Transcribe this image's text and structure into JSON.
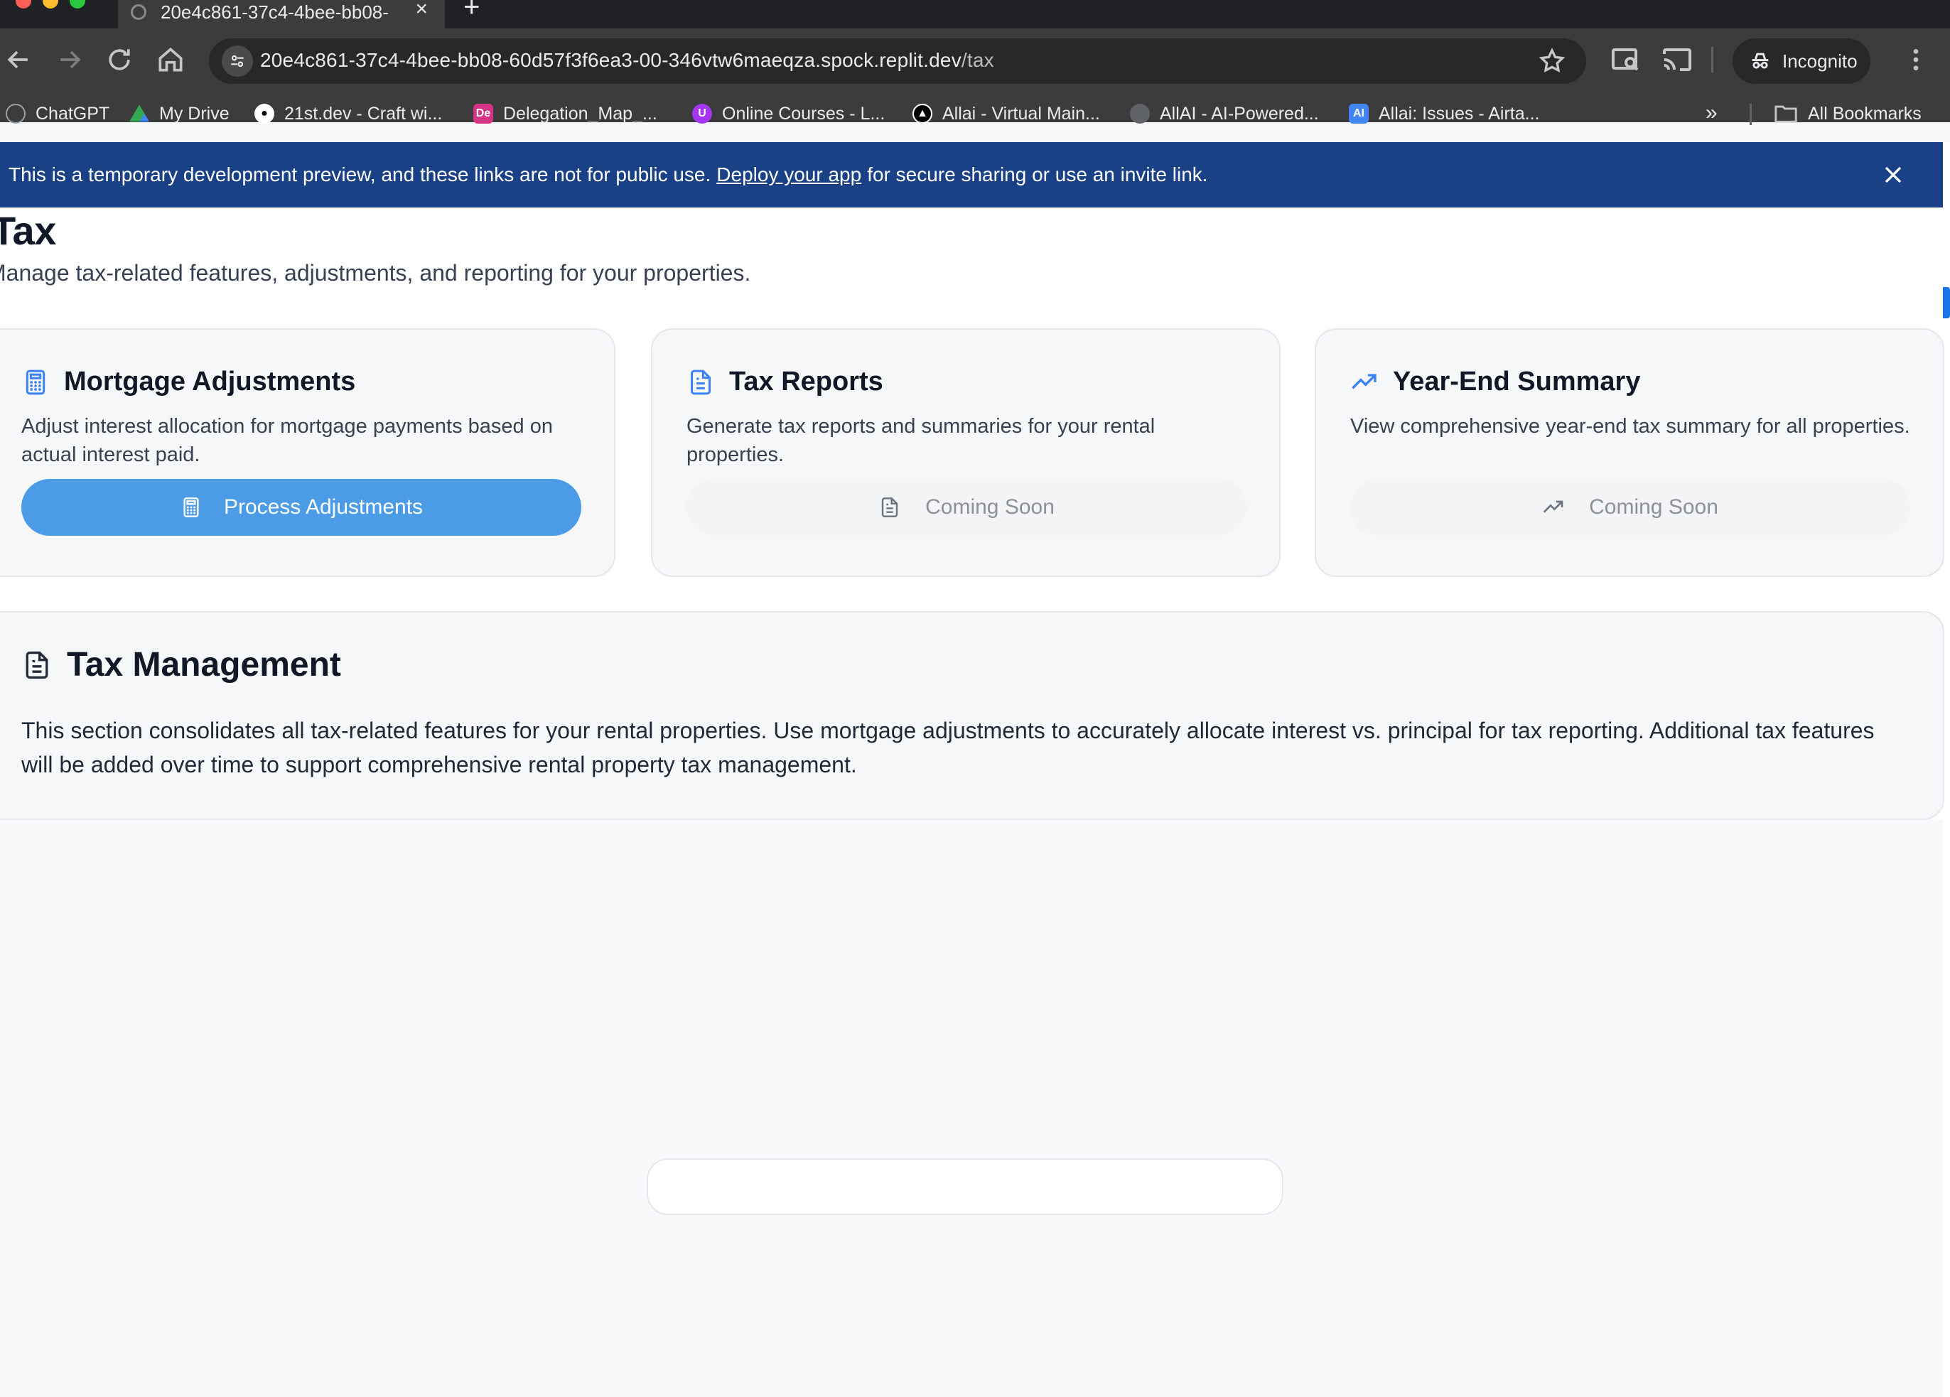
{
  "browser": {
    "tab_title": "20e4c861-37c4-4bee-bb08-",
    "url_host": "20e4c861-37c4-4bee-bb08-60d57f3f6ea3-00-346vtw6maeqza.spock.replit.dev",
    "url_path": "/tax",
    "incognito_label": "Incognito",
    "bookmarks": [
      {
        "label": "ChatGPT",
        "icon": "chatgpt-icon",
        "color": "#3c3c3c"
      },
      {
        "label": "My Drive",
        "icon": "google-drive-icon",
        "color": "#34a853"
      },
      {
        "label": "21st.dev - Craft wi...",
        "icon": "21st-icon",
        "color": "#000000"
      },
      {
        "label": "Delegation_Map_...",
        "icon": "de-icon",
        "color": "#d63384"
      },
      {
        "label": "Online Courses - L...",
        "icon": "udemy-icon",
        "color": "#a435f0"
      },
      {
        "label": "Allai - Virtual Main...",
        "icon": "allai-icon",
        "color": "#000000"
      },
      {
        "label": "AllAI - AI-Powered...",
        "icon": "globe-icon",
        "color": "#5f6368"
      },
      {
        "label": "Allai: Issues - Airta...",
        "icon": "ai-icon",
        "color": "#4285f4"
      }
    ],
    "all_bookmarks_label": "All Bookmarks"
  },
  "banner": {
    "text_before": "This is a temporary development preview, and these links are not for public use.",
    "link": "Deploy your app",
    "text_after": "for secure sharing or use an invite link."
  },
  "page": {
    "title": "Tax",
    "subtitle": "Manage tax-related features, adjustments, and reporting for your properties."
  },
  "cards": [
    {
      "title": "Mortgage Adjustments",
      "icon": "calculator-icon",
      "description": "Adjust interest allocation for mortgage payments based on actual interest paid.",
      "button": "Process Adjustments"
    },
    {
      "title": "Tax Reports",
      "icon": "document-icon",
      "description": "Generate tax reports and summaries for your rental properties.",
      "button": "Coming Soon"
    },
    {
      "title": "Year-End Summary",
      "icon": "trending-up-icon",
      "description": "View comprehensive year-end tax summary for all properties.",
      "button": "Coming Soon"
    }
  ],
  "management": {
    "title": "Tax Management",
    "body": "This section consolidates all tax-related features for your rental properties. Use mortgage adjustments to accurately allocate interest vs. principal for tax reporting. Additional tax features will be added over time to support comprehensive rental property tax management."
  },
  "colors": {
    "accent": "#4b9be6",
    "icon_blue": "#3b82f6",
    "banner": "#1a4185"
  }
}
